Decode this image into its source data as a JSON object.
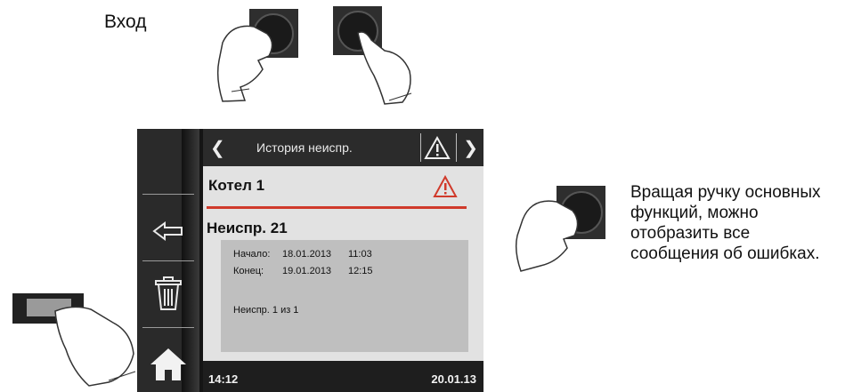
{
  "entry_label": "Вход",
  "device": {
    "header": {
      "title": "История неиспр.",
      "back_icon": "chevron-left-icon",
      "forward_icon": "chevron-right-icon",
      "warning_icon": "warning-triangle-icon"
    },
    "sidebar": {
      "buttons": [
        {
          "icon": "back-arrow-icon"
        },
        {
          "icon": "trash-icon"
        },
        {
          "icon": "home-icon"
        }
      ]
    },
    "content": {
      "boiler": "Котел 1",
      "fault_title": "Неиспр. 21",
      "start_label": "Начало:",
      "start_date": "18.01.2013",
      "start_time": "11:03",
      "end_label": "Конец:",
      "end_date": "19.01.2013",
      "end_time": "12:15",
      "counter": "Неиспр. 1 из 1"
    },
    "status": {
      "time": "14:12",
      "date": "20.01.13"
    },
    "colors": {
      "accent_red": "#d03a2b",
      "content_bg": "#e2e2e2",
      "detail_bg": "#bfbfbf"
    }
  },
  "instruction": "Вращая ручку основных функций, можно отобразить все сообщения об ошибках."
}
